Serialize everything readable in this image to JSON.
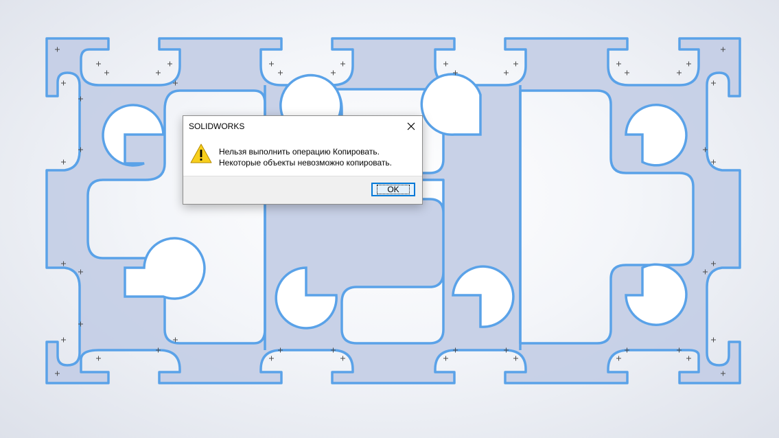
{
  "dialog": {
    "title": "SOLIDWORKS",
    "message_line1": "Нельзя выполнить операцию Копировать.",
    "message_line2": "Некоторые объекты невозможно копировать.",
    "ok_label": "OK",
    "icons": {
      "close": "close-icon",
      "warning": "warning-icon"
    }
  },
  "viewport": {
    "content": "sketch-profile-selected",
    "colors": {
      "profile_fill": "#c5cfe6",
      "profile_edge": "#5aa2e8",
      "background_center": "#ffffff",
      "background_edge": "#dde1ea"
    }
  }
}
